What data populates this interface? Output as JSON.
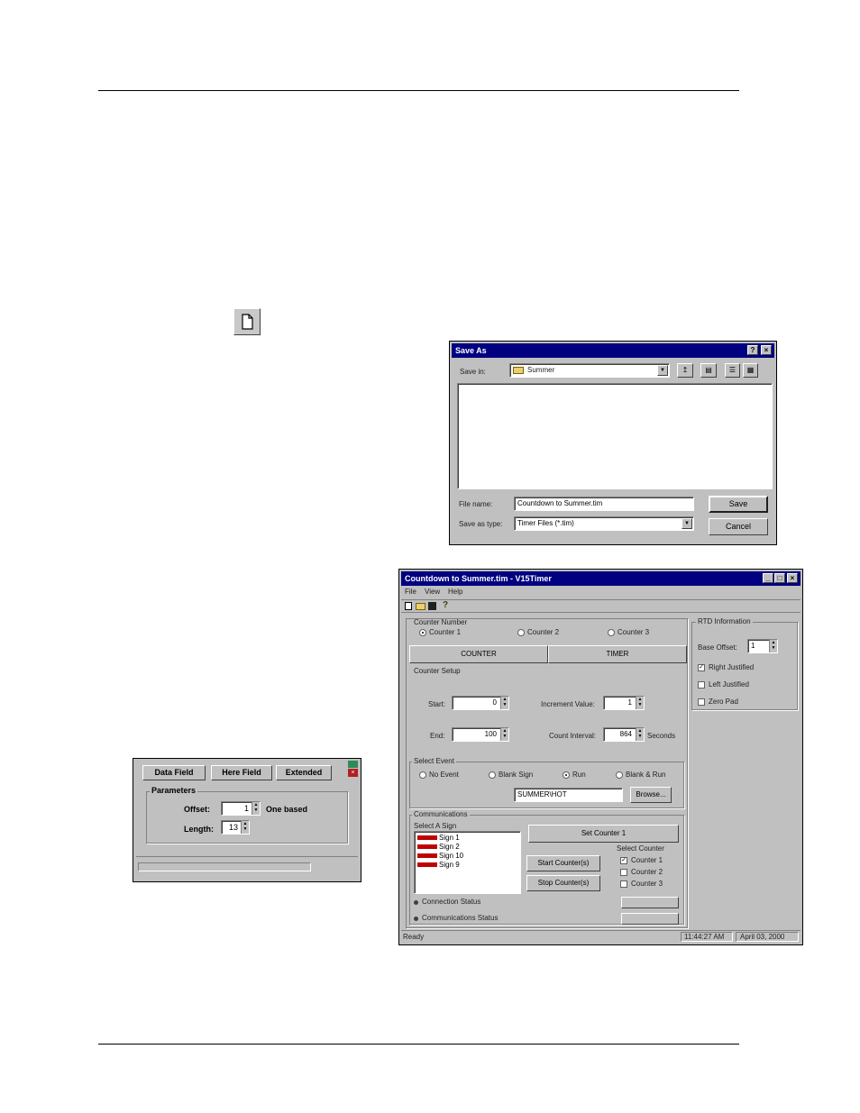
{
  "new_doc_icon": "new-document-icon",
  "save_as": {
    "title": "Save As",
    "save_in_label": "Save in:",
    "save_in_value": "Summer",
    "file_name_label": "File name:",
    "file_name_value": "Countdown to Summer.tim",
    "save_type_label": "Save as type:",
    "save_type_value": "Timer Files (*.tim)",
    "save_button": "Save",
    "cancel_button": "Cancel",
    "help_glyph": "?",
    "close_glyph": "×"
  },
  "field_panel": {
    "tabs": [
      "Data Field",
      "Here Field",
      "Extended"
    ],
    "group_title": "Parameters",
    "offset_label": "Offset:",
    "offset_value": "1",
    "one_based_label": "One based",
    "length_label": "Length:",
    "length_value": "13"
  },
  "timer_app": {
    "title": "Countdown to Summer.tim - V15Timer",
    "menu": [
      "File",
      "View",
      "Help"
    ],
    "counter_number_label": "Counter Number",
    "counters": [
      "Counter 1",
      "Counter 2",
      "Counter 3"
    ],
    "tabs": [
      "COUNTER",
      "TIMER"
    ],
    "counter_setup_label": "Counter Setup",
    "start_label": "Start:",
    "start_value": "0",
    "increment_label": "Increment Value:",
    "increment_value": "1",
    "end_label": "End:",
    "end_value": "100",
    "count_interval_label": "Count Interval:",
    "count_interval_value": "864",
    "seconds_label": "Seconds",
    "select_event_label": "Select Event",
    "events": [
      "No Event",
      "Blank Sign",
      "Run",
      "Blank & Run"
    ],
    "event_file": "SUMMER\\HOT",
    "browse_button": "Browse...",
    "communications_label": "Communications",
    "select_sign_label": "Select A Sign",
    "signs": [
      "Sign 1",
      "Sign 2",
      "Sign 10",
      "Sign 9"
    ],
    "set_counter_button": "Set Counter 1",
    "start_counters_button": "Start Counter(s)",
    "stop_counters_button": "Stop Counter(s)",
    "select_counter_label": "Select Counter",
    "select_counters": [
      "Counter 1",
      "Counter 2",
      "Counter 3"
    ],
    "connection_status_label": "Connection Status",
    "communications_status_label": "Communications Status",
    "rtd_label": "RTD Information",
    "base_offset_label": "Base Offset:",
    "base_offset_value": "1",
    "right_justified": "Right Justified",
    "left_justified": "Left Justified",
    "zero_pad": "Zero Pad",
    "status_ready": "Ready",
    "status_time": "11:44:27 AM",
    "status_date": "April 03, 2000"
  }
}
